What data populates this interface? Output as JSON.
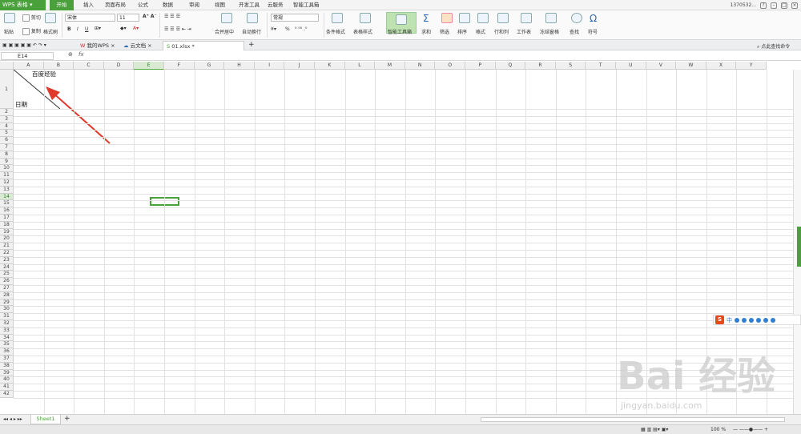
{
  "app": {
    "logo_label": "WPS 表格",
    "account": "1370532...",
    "window_controls": [
      "min",
      "max",
      "close"
    ]
  },
  "menu_tabs": [
    "开始",
    "插入",
    "页面布局",
    "公式",
    "数据",
    "审阅",
    "视图",
    "开发工具",
    "云服务",
    "智能工具箱"
  ],
  "ribbon": {
    "paste": "粘贴",
    "cut": "剪切",
    "copy": "复制",
    "format_painter": "格式刷",
    "font_name": "宋体",
    "font_size": "11",
    "merge_center": "合并居中",
    "wrap_text": "自动换行",
    "number_format": "常规",
    "percent": "%",
    "conditional_format": "条件格式",
    "table_style": "表格样式",
    "smart_toolbox": "智能工具箱",
    "sum": "求和",
    "filter": "筛选",
    "sort": "排序",
    "format": "格式",
    "rows_cols": "行和列",
    "worksheet": "工作表",
    "freeze": "冻结窗格",
    "find": "查找",
    "symbol": "符号"
  },
  "doc_tabs": [
    {
      "label": "我的WPS",
      "active": false
    },
    {
      "label": "云文档",
      "active": false
    },
    {
      "label": "01.xlsx *",
      "active": true
    }
  ],
  "search_hint": "点此查找命令",
  "name_box": "E14",
  "fx_label": "fx",
  "columns": [
    "A",
    "B",
    "C",
    "D",
    "E",
    "F",
    "G",
    "H",
    "I",
    "J",
    "K",
    "L",
    "M",
    "N",
    "O",
    "P",
    "Q",
    "R",
    "S",
    "T",
    "U",
    "V",
    "W",
    "X",
    "Y"
  ],
  "rows": [
    "1",
    "2",
    "3",
    "4",
    "5",
    "6",
    "7",
    "8",
    "9",
    "10",
    "11",
    "12",
    "13",
    "14",
    "15",
    "16",
    "17",
    "18",
    "19",
    "20",
    "21",
    "22",
    "23",
    "24",
    "25",
    "26",
    "27",
    "28",
    "29",
    "30",
    "31",
    "32",
    "33",
    "34",
    "35",
    "36",
    "37",
    "38",
    "39",
    "40",
    "41",
    "42"
  ],
  "selected_cell": {
    "column": "E",
    "row": "14"
  },
  "cells": {
    "a1_top_right": "百度经验",
    "a1_bottom_left": "日期"
  },
  "sheet_tab": "Sheet1",
  "ime_label": "中",
  "zoom": "100 %",
  "watermark": {
    "main": "Bai 经验",
    "sub": "jingyan.baidu.com"
  },
  "colors": {
    "accent": "#4aa03a",
    "arrow": "#e0392b"
  }
}
